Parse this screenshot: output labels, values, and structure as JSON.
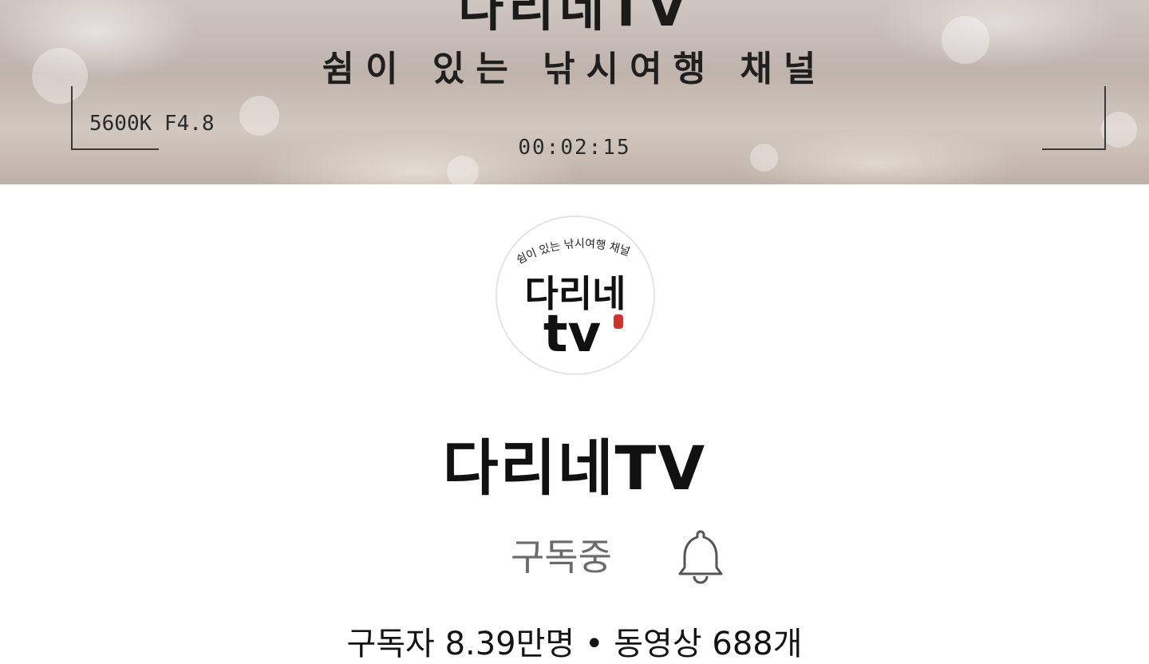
{
  "banner": {
    "title": "다리네TV",
    "subtitle": "쉼이 있는 낚시여행 채널",
    "camera_info": "5600K F4.8",
    "timecode": "00:02:15"
  },
  "avatar": {
    "logo_top_text": "쉼이 있는 낚시여행 채널",
    "logo_main_text": "다리네",
    "logo_sub_text": "tv"
  },
  "channel": {
    "name": "다리네TV",
    "subscribe_label": "구독중",
    "stats": "구독자 8.39만명 • 동영상 688개"
  },
  "icons": {
    "notification": "bell-icon"
  }
}
